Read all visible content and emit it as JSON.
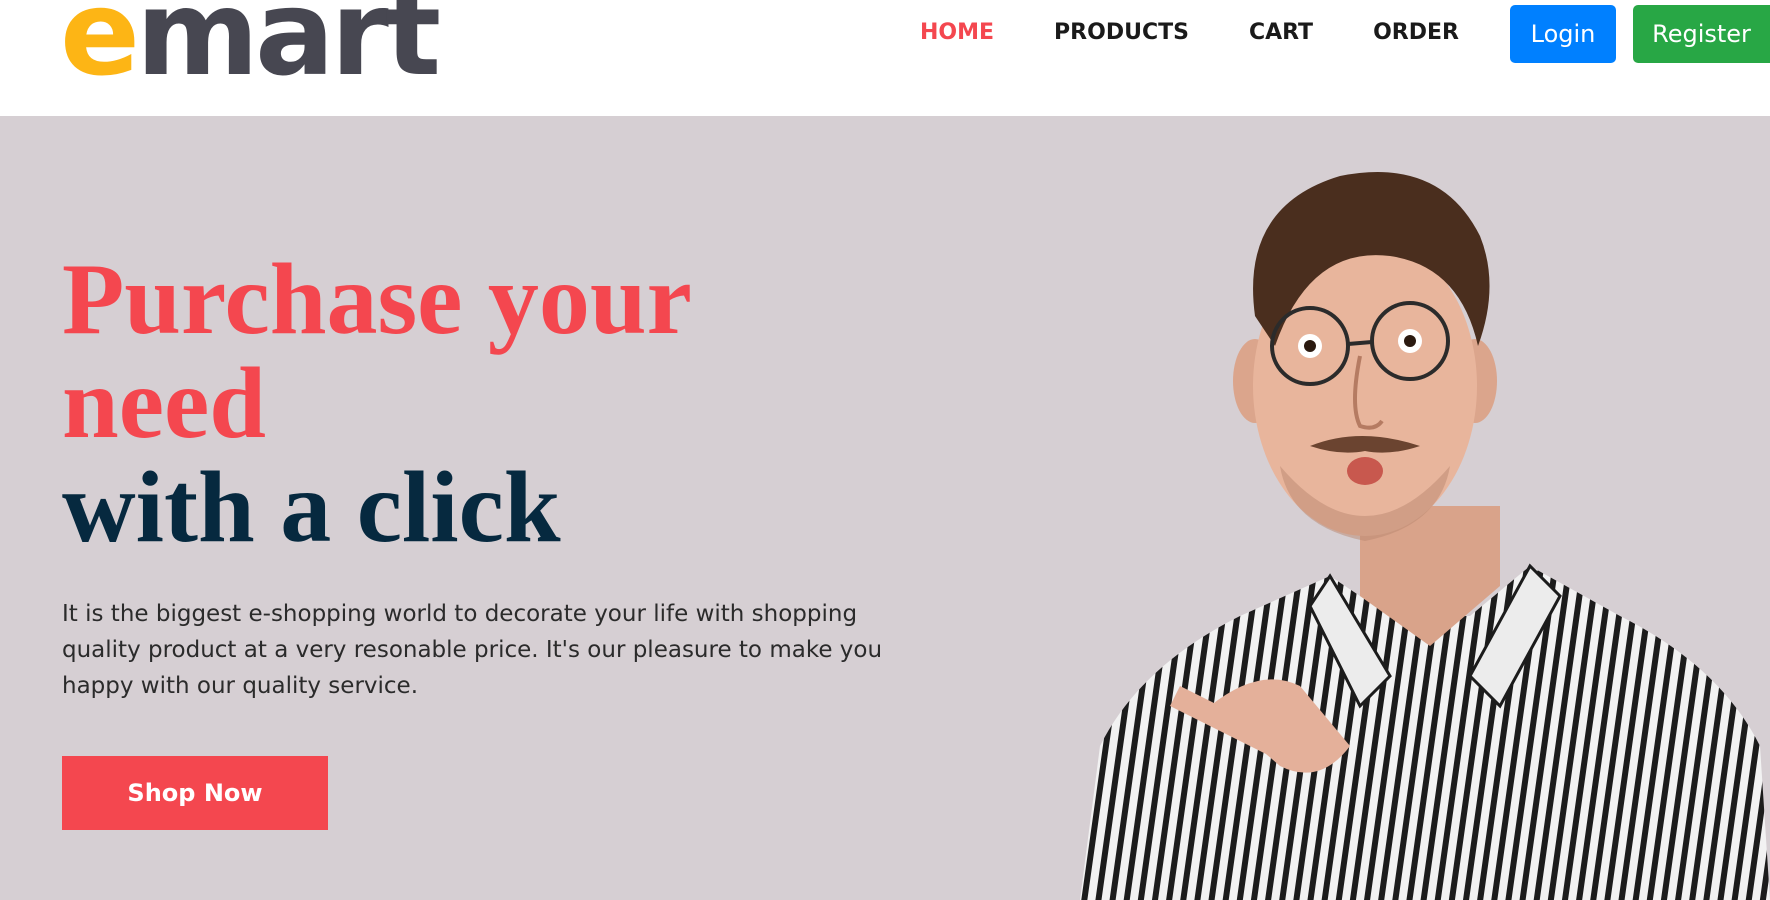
{
  "header": {
    "logo": {
      "first": "e",
      "rest": "mart"
    },
    "nav": [
      {
        "label": "HOME"
      },
      {
        "label": "PRODUCTS"
      },
      {
        "label": "CART"
      },
      {
        "label": "ORDER"
      }
    ],
    "login_label": "Login",
    "register_label": "Register"
  },
  "hero": {
    "headline": {
      "line1": "Purchase your",
      "line2": "need",
      "line3": "with a click"
    },
    "description": "It is the biggest e-shopping world to decorate your life with shopping quality product at a very resonable price. It's our pleasure to make you happy with our quality service.",
    "cta_label": "Shop Now"
  },
  "colors": {
    "accent": "#f4474f",
    "logo_yellow": "#fdb515",
    "logo_gray": "#474751",
    "headline_dark": "#06293f",
    "hero_bg": "#d6cfd3",
    "login_blue": "#0080ff",
    "register_green": "#28a745"
  },
  "icons": {
    "hero_image": "man-pointing-photo"
  }
}
